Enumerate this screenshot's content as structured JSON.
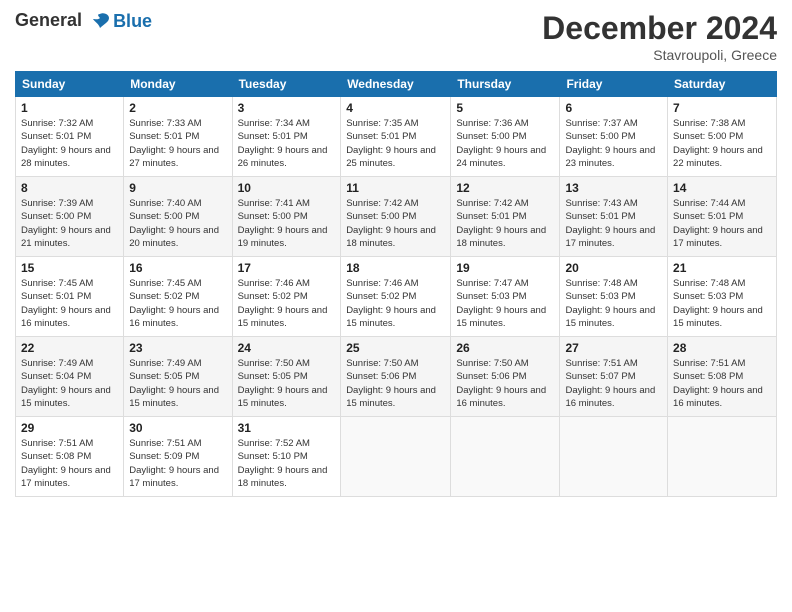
{
  "header": {
    "logo_line1": "General",
    "logo_line2": "Blue",
    "month_year": "December 2024",
    "location": "Stavroupoli, Greece"
  },
  "weekdays": [
    "Sunday",
    "Monday",
    "Tuesday",
    "Wednesday",
    "Thursday",
    "Friday",
    "Saturday"
  ],
  "weeks": [
    [
      {
        "day": "1",
        "sunrise": "Sunrise: 7:32 AM",
        "sunset": "Sunset: 5:01 PM",
        "daylight": "Daylight: 9 hours and 28 minutes."
      },
      {
        "day": "2",
        "sunrise": "Sunrise: 7:33 AM",
        "sunset": "Sunset: 5:01 PM",
        "daylight": "Daylight: 9 hours and 27 minutes."
      },
      {
        "day": "3",
        "sunrise": "Sunrise: 7:34 AM",
        "sunset": "Sunset: 5:01 PM",
        "daylight": "Daylight: 9 hours and 26 minutes."
      },
      {
        "day": "4",
        "sunrise": "Sunrise: 7:35 AM",
        "sunset": "Sunset: 5:01 PM",
        "daylight": "Daylight: 9 hours and 25 minutes."
      },
      {
        "day": "5",
        "sunrise": "Sunrise: 7:36 AM",
        "sunset": "Sunset: 5:00 PM",
        "daylight": "Daylight: 9 hours and 24 minutes."
      },
      {
        "day": "6",
        "sunrise": "Sunrise: 7:37 AM",
        "sunset": "Sunset: 5:00 PM",
        "daylight": "Daylight: 9 hours and 23 minutes."
      },
      {
        "day": "7",
        "sunrise": "Sunrise: 7:38 AM",
        "sunset": "Sunset: 5:00 PM",
        "daylight": "Daylight: 9 hours and 22 minutes."
      }
    ],
    [
      {
        "day": "8",
        "sunrise": "Sunrise: 7:39 AM",
        "sunset": "Sunset: 5:00 PM",
        "daylight": "Daylight: 9 hours and 21 minutes."
      },
      {
        "day": "9",
        "sunrise": "Sunrise: 7:40 AM",
        "sunset": "Sunset: 5:00 PM",
        "daylight": "Daylight: 9 hours and 20 minutes."
      },
      {
        "day": "10",
        "sunrise": "Sunrise: 7:41 AM",
        "sunset": "Sunset: 5:00 PM",
        "daylight": "Daylight: 9 hours and 19 minutes."
      },
      {
        "day": "11",
        "sunrise": "Sunrise: 7:42 AM",
        "sunset": "Sunset: 5:00 PM",
        "daylight": "Daylight: 9 hours and 18 minutes."
      },
      {
        "day": "12",
        "sunrise": "Sunrise: 7:42 AM",
        "sunset": "Sunset: 5:01 PM",
        "daylight": "Daylight: 9 hours and 18 minutes."
      },
      {
        "day": "13",
        "sunrise": "Sunrise: 7:43 AM",
        "sunset": "Sunset: 5:01 PM",
        "daylight": "Daylight: 9 hours and 17 minutes."
      },
      {
        "day": "14",
        "sunrise": "Sunrise: 7:44 AM",
        "sunset": "Sunset: 5:01 PM",
        "daylight": "Daylight: 9 hours and 17 minutes."
      }
    ],
    [
      {
        "day": "15",
        "sunrise": "Sunrise: 7:45 AM",
        "sunset": "Sunset: 5:01 PM",
        "daylight": "Daylight: 9 hours and 16 minutes."
      },
      {
        "day": "16",
        "sunrise": "Sunrise: 7:45 AM",
        "sunset": "Sunset: 5:02 PM",
        "daylight": "Daylight: 9 hours and 16 minutes."
      },
      {
        "day": "17",
        "sunrise": "Sunrise: 7:46 AM",
        "sunset": "Sunset: 5:02 PM",
        "daylight": "Daylight: 9 hours and 15 minutes."
      },
      {
        "day": "18",
        "sunrise": "Sunrise: 7:46 AM",
        "sunset": "Sunset: 5:02 PM",
        "daylight": "Daylight: 9 hours and 15 minutes."
      },
      {
        "day": "19",
        "sunrise": "Sunrise: 7:47 AM",
        "sunset": "Sunset: 5:03 PM",
        "daylight": "Daylight: 9 hours and 15 minutes."
      },
      {
        "day": "20",
        "sunrise": "Sunrise: 7:48 AM",
        "sunset": "Sunset: 5:03 PM",
        "daylight": "Daylight: 9 hours and 15 minutes."
      },
      {
        "day": "21",
        "sunrise": "Sunrise: 7:48 AM",
        "sunset": "Sunset: 5:03 PM",
        "daylight": "Daylight: 9 hours and 15 minutes."
      }
    ],
    [
      {
        "day": "22",
        "sunrise": "Sunrise: 7:49 AM",
        "sunset": "Sunset: 5:04 PM",
        "daylight": "Daylight: 9 hours and 15 minutes."
      },
      {
        "day": "23",
        "sunrise": "Sunrise: 7:49 AM",
        "sunset": "Sunset: 5:05 PM",
        "daylight": "Daylight: 9 hours and 15 minutes."
      },
      {
        "day": "24",
        "sunrise": "Sunrise: 7:50 AM",
        "sunset": "Sunset: 5:05 PM",
        "daylight": "Daylight: 9 hours and 15 minutes."
      },
      {
        "day": "25",
        "sunrise": "Sunrise: 7:50 AM",
        "sunset": "Sunset: 5:06 PM",
        "daylight": "Daylight: 9 hours and 15 minutes."
      },
      {
        "day": "26",
        "sunrise": "Sunrise: 7:50 AM",
        "sunset": "Sunset: 5:06 PM",
        "daylight": "Daylight: 9 hours and 16 minutes."
      },
      {
        "day": "27",
        "sunrise": "Sunrise: 7:51 AM",
        "sunset": "Sunset: 5:07 PM",
        "daylight": "Daylight: 9 hours and 16 minutes."
      },
      {
        "day": "28",
        "sunrise": "Sunrise: 7:51 AM",
        "sunset": "Sunset: 5:08 PM",
        "daylight": "Daylight: 9 hours and 16 minutes."
      }
    ],
    [
      {
        "day": "29",
        "sunrise": "Sunrise: 7:51 AM",
        "sunset": "Sunset: 5:08 PM",
        "daylight": "Daylight: 9 hours and 17 minutes."
      },
      {
        "day": "30",
        "sunrise": "Sunrise: 7:51 AM",
        "sunset": "Sunset: 5:09 PM",
        "daylight": "Daylight: 9 hours and 17 minutes."
      },
      {
        "day": "31",
        "sunrise": "Sunrise: 7:52 AM",
        "sunset": "Sunset: 5:10 PM",
        "daylight": "Daylight: 9 hours and 18 minutes."
      },
      null,
      null,
      null,
      null
    ]
  ]
}
